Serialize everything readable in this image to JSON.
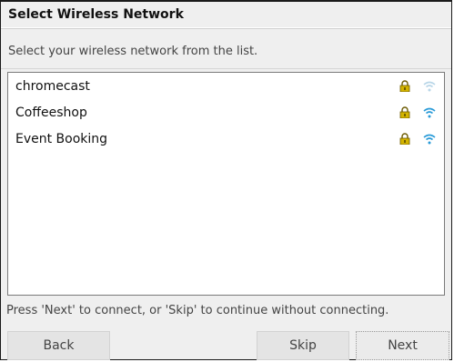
{
  "dialog": {
    "title": "Select Wireless Network",
    "subtitle": "Select your wireless network from the list.",
    "networks": [
      {
        "name": "chromecast",
        "secured": true,
        "lock_icon": "lock-icon",
        "signal_icon": "wifi-weak-icon",
        "signal_color": "#b9d6e8"
      },
      {
        "name": "Coffeeshop",
        "secured": true,
        "lock_icon": "lock-icon",
        "signal_icon": "wifi-strong-icon",
        "signal_color": "#2a9bd8"
      },
      {
        "name": "Event Booking",
        "secured": true,
        "lock_icon": "lock-icon",
        "signal_icon": "wifi-strong-icon",
        "signal_color": "#2a9bd8"
      }
    ],
    "footer_text": "Press 'Next' to connect, or 'Skip' to continue without connecting.",
    "buttons": {
      "back": "Back",
      "skip": "Skip",
      "next": "Next"
    }
  },
  "colors": {
    "lock_body": "#d4b400",
    "signal_strong": "#2a9bd8",
    "signal_weak": "#b9d6e8"
  }
}
